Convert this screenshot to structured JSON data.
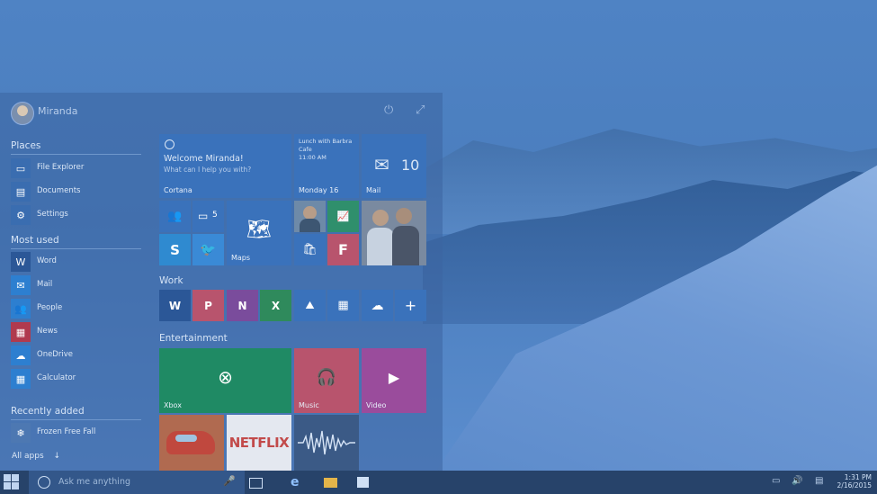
{
  "user": {
    "name": "Miranda"
  },
  "places": {
    "title": "Places",
    "items": [
      {
        "label": "File Explorer",
        "icon": "folder-icon"
      },
      {
        "label": "Documents",
        "icon": "documents-icon"
      },
      {
        "label": "Settings",
        "icon": "gear-icon"
      }
    ]
  },
  "most_used": {
    "title": "Most used",
    "items": [
      {
        "label": "Word",
        "icon": "word-icon",
        "color": "#2b5797"
      },
      {
        "label": "Mail",
        "icon": "mail-icon",
        "color": "#2d7fd0"
      },
      {
        "label": "People",
        "icon": "people-icon",
        "color": "#2d7fd0"
      },
      {
        "label": "News",
        "icon": "news-icon",
        "color": "#b03a4e"
      },
      {
        "label": "OneDrive",
        "icon": "onedrive-icon",
        "color": "#2d7fd0"
      },
      {
        "label": "Calculator",
        "icon": "calculator-icon",
        "color": "#2d7fd0"
      }
    ]
  },
  "recently_added": {
    "title": "Recently added",
    "items": [
      {
        "label": "Frozen Free Fall",
        "icon": "frozen-app-icon"
      }
    ]
  },
  "all_apps": {
    "label": "All apps",
    "arrow": "↓"
  },
  "tiles": {
    "cortana": {
      "title": "Welcome Miranda!",
      "subtitle": "What can I help you with?",
      "label": "Cortana"
    },
    "calendar": {
      "line1": "Lunch with Barbra",
      "line2": "Cafe",
      "line3": "11:00 AM",
      "label": "Monday 16"
    },
    "mail": {
      "count": "10",
      "label": "Mail"
    },
    "messaging_count": "5",
    "maps": {
      "label": "Maps"
    },
    "netflix": {
      "text": "NETFLIX"
    },
    "xbox": {
      "label": "Xbox"
    },
    "music": {
      "label": "Music"
    },
    "video": {
      "label": "Video"
    }
  },
  "groups": {
    "work": "Work",
    "entertainment": "Entertainment"
  },
  "taskbar": {
    "search_placeholder": "Ask me anything",
    "time": "1:31 PM",
    "date": "2/16/2015"
  },
  "colors": {
    "accent": "#2d7fd0",
    "xbox": "#1f8a64",
    "music": "#b8546d",
    "video": "#9a4c9c",
    "taskbar": "#27436a"
  }
}
